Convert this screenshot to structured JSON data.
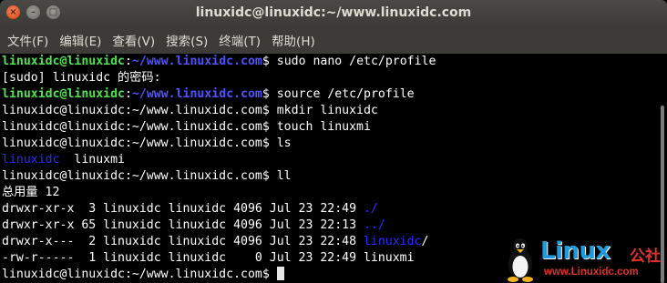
{
  "window": {
    "title": "linuxidc@linuxidc:~/www.linuxidc.com",
    "close_glyph": "×",
    "minimize_glyph": "–",
    "maximize_glyph": "□"
  },
  "menu": [
    {
      "label": "文件(F)"
    },
    {
      "label": "编辑(E)"
    },
    {
      "label": "查看(V)"
    },
    {
      "label": "搜索(S)"
    },
    {
      "label": "终端(T)"
    },
    {
      "label": "帮助(H)"
    }
  ],
  "terminal": {
    "user_host": "linuxidc@linuxidc",
    "colon": ":",
    "path": "~/www.linuxidc.com",
    "dollar": "$ ",
    "plain_prompt": "linuxidc@linuxidc:~/www.linuxidc.com$ ",
    "lines": {
      "l1_cmd": "sudo nano /etc/profile",
      "l2": "[sudo] linuxidc 的密码:",
      "l3_cmd": "source /etc/profile",
      "l4_cmd": "mkdir linuxidc",
      "l5_cmd": "touch linuxmi",
      "l6_cmd": "ls",
      "l7_dir": "linuxidc",
      "l7_file": "  linuxmi",
      "l8_cmd": "ll",
      "l9": "总用量 12",
      "l10_pre": "drwxr-xr-x  3 linuxidc linuxidc 4096 Jul 23 22:49 ",
      "l10_dir": "./",
      "l11_pre": "drwxr-xr-x 65 linuxidc linuxidc 4096 Jul 23 22:13 ",
      "l11_dir": "../",
      "l12_pre": "drwxr-x---  2 linuxidc linuxidc 4096 Jul 23 22:48 ",
      "l12_dir": "linuxidc",
      "l12_slash": "/",
      "l13": "-rw-r-----  1 linuxidc linuxidc    0 Jul 23 22:49 linuxmi"
    }
  },
  "watermark": {
    "brand": "Linux",
    "gongshe": "公社",
    "url": "www.Linuxidc.com"
  },
  "colors": {
    "prompt_user": "#4ee44e",
    "prompt_path": "#5151ff",
    "directory": "#2a2aff",
    "titlebar": "#3c3b37",
    "close_button": "#e0521f"
  }
}
